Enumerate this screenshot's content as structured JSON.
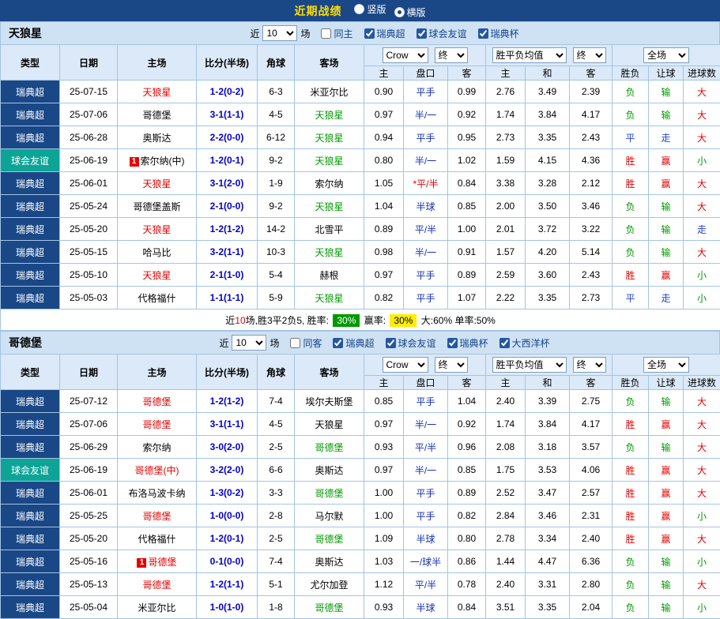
{
  "topbar": {
    "title": "近期战绩",
    "layout_options": [
      {
        "label": "竖版",
        "selected": false
      },
      {
        "label": "横版",
        "selected": true
      }
    ]
  },
  "table_header": {
    "main_cols": [
      "类型",
      "日期",
      "主场",
      "比分(半场)",
      "角球",
      "客场"
    ],
    "sub_cols": [
      "主",
      "盘口",
      "客",
      "主",
      "和",
      "客",
      "胜负",
      "让球",
      "进球数"
    ],
    "bookmaker_select": "Crow",
    "asian_time_select": "终",
    "europe_select": "胜平负均值",
    "europe_time_select": "终",
    "scope_select": "全场"
  },
  "colors": {
    "result": {
      "胜": "#e60000",
      "赢": "#e60000",
      "大": "#e60000",
      "负": "#009900",
      "输": "#009900",
      "小": "#009900",
      "平": "#2244cc",
      "走": "#2244cc"
    },
    "team": {
      "red": "#e60000",
      "green": "#009900",
      "black": "#000000"
    },
    "league": {
      "瑞典超": "#1a4786",
      "球会友谊": "#0da496"
    }
  },
  "sections": [
    {
      "team": "天狼星",
      "filters": {
        "near": "近",
        "count": "10",
        "unit": "场",
        "checkboxes": [
          {
            "label": "同主",
            "checked": false
          },
          {
            "label": "瑞典超",
            "checked": true
          },
          {
            "label": "球会友谊",
            "checked": true
          },
          {
            "label": "瑞典杯",
            "checked": true
          }
        ]
      },
      "rows": [
        {
          "league": "瑞典超",
          "date": "25-07-15",
          "home": "天狼星",
          "home_color": "red",
          "score": "1-2(0-2)",
          "corner": "6-3",
          "away": "米亚尔比",
          "away_color": "black",
          "asian": [
            "0.90",
            "平手",
            "0.99"
          ],
          "europe": [
            "2.76",
            "3.49",
            "2.39"
          ],
          "results": [
            "负",
            "输",
            "大"
          ]
        },
        {
          "league": "瑞典超",
          "date": "25-07-06",
          "home": "哥德堡",
          "home_color": "black",
          "score": "3-1(1-1)",
          "corner": "4-5",
          "away": "天狼星",
          "away_color": "green",
          "asian": [
            "0.97",
            "半/一",
            "0.92"
          ],
          "europe": [
            "1.74",
            "3.84",
            "4.17"
          ],
          "results": [
            "负",
            "输",
            "大"
          ]
        },
        {
          "league": "瑞典超",
          "date": "25-06-28",
          "home": "奥斯达",
          "home_color": "black",
          "score": "2-2(0-0)",
          "corner": "6-12",
          "away": "天狼星",
          "away_color": "green",
          "asian": [
            "0.94",
            "平手",
            "0.95"
          ],
          "europe": [
            "2.73",
            "3.35",
            "2.43"
          ],
          "results": [
            "平",
            "走",
            "大"
          ]
        },
        {
          "league": "球会友谊",
          "date": "25-06-19",
          "home": "索尔纳(中)",
          "home_color": "black",
          "home_badge": "1",
          "score": "1-2(0-1)",
          "corner": "9-2",
          "away": "天狼星",
          "away_color": "green",
          "asian": [
            "0.80",
            "半/一",
            "1.02"
          ],
          "europe": [
            "1.59",
            "4.15",
            "4.36"
          ],
          "results": [
            "胜",
            "赢",
            "小"
          ]
        },
        {
          "league": "瑞典超",
          "date": "25-06-01",
          "home": "天狼星",
          "home_color": "red",
          "score": "3-1(2-0)",
          "corner": "1-9",
          "away": "索尔纳",
          "away_color": "black",
          "asian": [
            "1.05",
            "*平/半",
            "0.84"
          ],
          "asian_red": true,
          "europe": [
            "3.38",
            "3.28",
            "2.12"
          ],
          "results": [
            "胜",
            "赢",
            "大"
          ]
        },
        {
          "league": "瑞典超",
          "date": "25-05-24",
          "home": "哥德堡盖斯",
          "home_color": "black",
          "score": "2-1(0-0)",
          "corner": "9-2",
          "away": "天狼星",
          "away_color": "green",
          "asian": [
            "1.04",
            "半球",
            "0.85"
          ],
          "europe": [
            "2.00",
            "3.50",
            "3.46"
          ],
          "results": [
            "负",
            "输",
            "大"
          ]
        },
        {
          "league": "瑞典超",
          "date": "25-05-20",
          "home": "天狼星",
          "home_color": "red",
          "score": "1-2(1-2)",
          "corner": "14-2",
          "away": "北雪平",
          "away_color": "black",
          "asian": [
            "0.89",
            "平/半",
            "1.00"
          ],
          "europe": [
            "2.01",
            "3.72",
            "3.22"
          ],
          "results": [
            "负",
            "输",
            "走"
          ]
        },
        {
          "league": "瑞典超",
          "date": "25-05-15",
          "home": "哈马比",
          "home_color": "black",
          "score": "3-2(1-1)",
          "corner": "10-3",
          "away": "天狼星",
          "away_color": "green",
          "asian": [
            "0.98",
            "半/一",
            "0.91"
          ],
          "europe": [
            "1.57",
            "4.20",
            "5.14"
          ],
          "results": [
            "负",
            "输",
            "大"
          ]
        },
        {
          "league": "瑞典超",
          "date": "25-05-10",
          "home": "天狼星",
          "home_color": "red",
          "score": "2-1(1-0)",
          "corner": "5-4",
          "away": "赫根",
          "away_color": "black",
          "asian": [
            "0.97",
            "平手",
            "0.89"
          ],
          "europe": [
            "2.59",
            "3.60",
            "2.43"
          ],
          "results": [
            "胜",
            "赢",
            "小"
          ]
        },
        {
          "league": "瑞典超",
          "date": "25-05-03",
          "home": "代格福什",
          "home_color": "black",
          "score": "1-1(1-1)",
          "corner": "5-9",
          "away": "天狼星",
          "away_color": "green",
          "asian": [
            "0.82",
            "平手",
            "1.07"
          ],
          "europe": [
            "2.22",
            "3.35",
            "2.73"
          ],
          "results": [
            "平",
            "走",
            "小"
          ]
        }
      ],
      "summary": [
        {
          "text": "近"
        },
        {
          "text": "10",
          "style": "red"
        },
        {
          "text": "场,胜3平2负5, 胜率: "
        },
        {
          "text": "30%",
          "style": "chip-green"
        },
        {
          "text": " 赢率: "
        },
        {
          "text": "30%",
          "style": "chip-yellow"
        },
        {
          "text": " 大:60% 单率:50%"
        }
      ]
    },
    {
      "team": "哥德堡",
      "filters": {
        "near": "近",
        "count": "10",
        "unit": "场",
        "checkboxes": [
          {
            "label": "同客",
            "checked": false
          },
          {
            "label": "瑞典超",
            "checked": true
          },
          {
            "label": "球会友谊",
            "checked": true
          },
          {
            "label": "瑞典杯",
            "checked": true
          },
          {
            "label": "大西洋杯",
            "checked": true
          }
        ]
      },
      "rows": [
        {
          "league": "瑞典超",
          "date": "25-07-12",
          "home": "哥德堡",
          "home_color": "red",
          "score": "1-2(1-2)",
          "corner": "7-4",
          "away": "埃尔夫斯堡",
          "away_color": "black",
          "asian": [
            "0.85",
            "平手",
            "1.04"
          ],
          "europe": [
            "2.40",
            "3.39",
            "2.75"
          ],
          "results": [
            "负",
            "输",
            "大"
          ]
        },
        {
          "league": "瑞典超",
          "date": "25-07-06",
          "home": "哥德堡",
          "home_color": "red",
          "score": "3-1(1-1)",
          "corner": "4-5",
          "away": "天狼星",
          "away_color": "black",
          "asian": [
            "0.97",
            "半/一",
            "0.92"
          ],
          "europe": [
            "1.74",
            "3.84",
            "4.17"
          ],
          "results": [
            "胜",
            "赢",
            "大"
          ]
        },
        {
          "league": "瑞典超",
          "date": "25-06-29",
          "home": "索尔纳",
          "home_color": "black",
          "score": "3-0(2-0)",
          "corner": "2-5",
          "away": "哥德堡",
          "away_color": "green",
          "asian": [
            "0.93",
            "平/半",
            "0.96"
          ],
          "europe": [
            "2.08",
            "3.18",
            "3.57"
          ],
          "results": [
            "负",
            "输",
            "大"
          ]
        },
        {
          "league": "球会友谊",
          "date": "25-06-19",
          "home": "哥德堡(中)",
          "home_color": "red",
          "score": "3-2(2-0)",
          "corner": "6-6",
          "away": "奥斯达",
          "away_color": "black",
          "asian": [
            "0.97",
            "半/一",
            "0.85"
          ],
          "europe": [
            "1.75",
            "3.53",
            "4.06"
          ],
          "results": [
            "胜",
            "赢",
            "大"
          ]
        },
        {
          "league": "瑞典超",
          "date": "25-06-01",
          "home": "布洛马波卡纳",
          "home_color": "black",
          "score": "1-3(0-2)",
          "corner": "3-3",
          "away": "哥德堡",
          "away_color": "green",
          "asian": [
            "1.00",
            "平手",
            "0.89"
          ],
          "europe": [
            "2.52",
            "3.47",
            "2.57"
          ],
          "results": [
            "胜",
            "赢",
            "大"
          ]
        },
        {
          "league": "瑞典超",
          "date": "25-05-25",
          "home": "哥德堡",
          "home_color": "red",
          "score": "1-0(0-0)",
          "corner": "2-8",
          "away": "马尔默",
          "away_color": "black",
          "asian": [
            "1.00",
            "平手",
            "0.82"
          ],
          "europe": [
            "2.84",
            "3.46",
            "2.31"
          ],
          "results": [
            "胜",
            "赢",
            "小"
          ]
        },
        {
          "league": "瑞典超",
          "date": "25-05-20",
          "home": "代格福什",
          "home_color": "black",
          "score": "1-2(0-1)",
          "corner": "2-5",
          "away": "哥德堡",
          "away_color": "green",
          "asian": [
            "1.09",
            "半球",
            "0.80"
          ],
          "europe": [
            "2.78",
            "3.34",
            "2.40"
          ],
          "results": [
            "胜",
            "赢",
            "大"
          ]
        },
        {
          "league": "瑞典超",
          "date": "25-05-16",
          "home": "哥德堡",
          "home_color": "red",
          "home_badge": "1",
          "score": "0-1(0-0)",
          "corner": "7-4",
          "away": "奥斯达",
          "away_color": "black",
          "asian": [
            "1.03",
            "一/球半",
            "0.86"
          ],
          "europe": [
            "1.44",
            "4.47",
            "6.36"
          ],
          "results": [
            "负",
            "输",
            "小"
          ]
        },
        {
          "league": "瑞典超",
          "date": "25-05-13",
          "home": "哥德堡",
          "home_color": "red",
          "score": "1-2(1-1)",
          "corner": "5-1",
          "away": "尤尔加登",
          "away_color": "black",
          "asian": [
            "1.12",
            "平/半",
            "0.78"
          ],
          "europe": [
            "2.40",
            "3.31",
            "2.80"
          ],
          "results": [
            "负",
            "输",
            "大"
          ]
        },
        {
          "league": "瑞典超",
          "date": "25-05-04",
          "home": "米亚尔比",
          "home_color": "black",
          "score": "1-0(1-0)",
          "corner": "1-8",
          "away": "哥德堡",
          "away_color": "green",
          "asian": [
            "0.93",
            "半球",
            "0.84"
          ],
          "europe": [
            "3.51",
            "3.35",
            "2.04"
          ],
          "results": [
            "负",
            "输",
            "小"
          ]
        }
      ],
      "summary": null
    }
  ]
}
